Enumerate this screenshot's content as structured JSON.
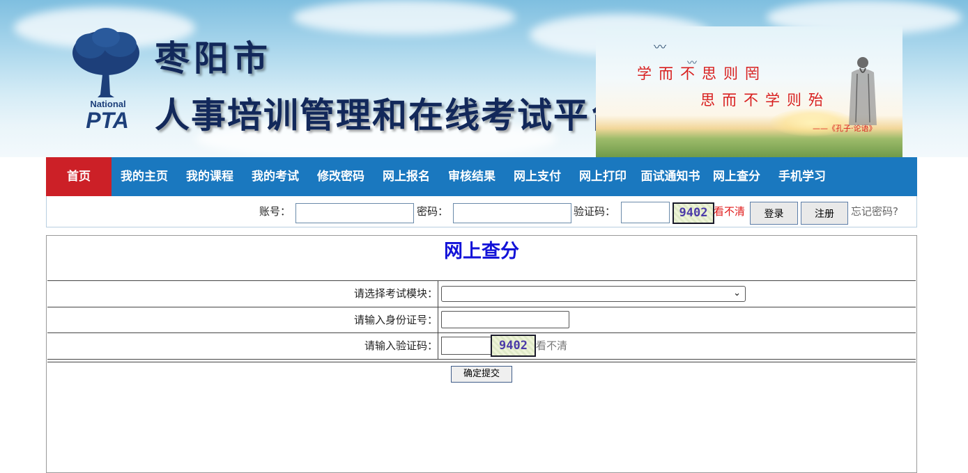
{
  "header": {
    "logo_small": "National",
    "logo_big": "PTA",
    "title_line1": "枣阳市",
    "title_line2": "人事培训管理和在线考试平台",
    "motto_line1": "学而不思则罔",
    "motto_line2": "思而不学则殆",
    "attribution": "——《孔子·论语》"
  },
  "nav": {
    "items": [
      {
        "label": "首页"
      },
      {
        "label": "我的主页"
      },
      {
        "label": "我的课程"
      },
      {
        "label": "我的考试"
      },
      {
        "label": "修改密码"
      },
      {
        "label": "网上报名"
      },
      {
        "label": "审核结果"
      },
      {
        "label": "网上支付"
      },
      {
        "label": "网上打印"
      },
      {
        "label": "面试通知书"
      },
      {
        "label": "网上查分"
      },
      {
        "label": "手机学习"
      }
    ]
  },
  "login": {
    "account_label": "账号：",
    "account_value": "",
    "password_label": "密码：",
    "password_value": "",
    "captcha_label": "验证码：",
    "captcha_value": "",
    "captcha_text": "9402",
    "refresh_text": "看不清",
    "login_button": "登录",
    "register_button": "注册",
    "forgot_link": "忘记密码?"
  },
  "query": {
    "title": "网上查分",
    "module_label": "请选择考试模块：",
    "module_selected": "",
    "id_label": "请输入身份证号：",
    "id_value": "",
    "captcha_label": "请输入验证码：",
    "captcha_value": "",
    "captcha_text": "9402",
    "refresh_text": "看不清",
    "submit_button": "确定提交"
  },
  "colors": {
    "nav_bg": "#1a78bf",
    "nav_active": "#cc2027",
    "title_blue": "#1212d8",
    "refresh_red": "#e01818",
    "refresh_gray": "#777777"
  }
}
